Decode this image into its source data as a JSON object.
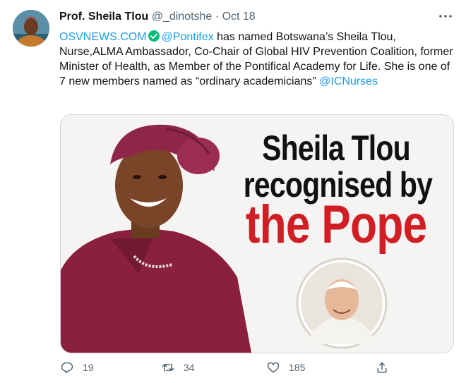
{
  "author": {
    "name": "Prof. Sheila Tlou",
    "handle": "@_dinotshe",
    "separator": "·",
    "timestamp": "Oct 18"
  },
  "tweet": {
    "mention_osv": "OSVNEWS.COM",
    "mention_pontifex": "@Pontifex",
    "text_part1": " has named Botswana’s Sheila Tlou, Nurse,ALMA Ambassador, Co-Chair of Global HIV Prevention Coalition, former Minister of Health, as Member of the Pontifical Academy for Life. She is one of 7 new members named as “ordinary academicians” ",
    "mention_icnurses": "@ICNurses"
  },
  "media": {
    "headline_line1": "Sheila Tlou",
    "headline_line2": "recognised by",
    "headline_line3": "the Pope"
  },
  "actions": {
    "reply_count": "19",
    "retweet_count": "34",
    "like_count": "185"
  },
  "icons": {
    "more": "more-dots-icon",
    "verified": "verified-badge-icon",
    "reply": "reply-icon",
    "retweet": "retweet-icon",
    "like": "like-icon",
    "share": "share-icon"
  },
  "colors": {
    "link": "#1d9bf0",
    "secondary_text": "#536471",
    "headline_red": "#d01e24",
    "verified": "#00ba7c"
  }
}
